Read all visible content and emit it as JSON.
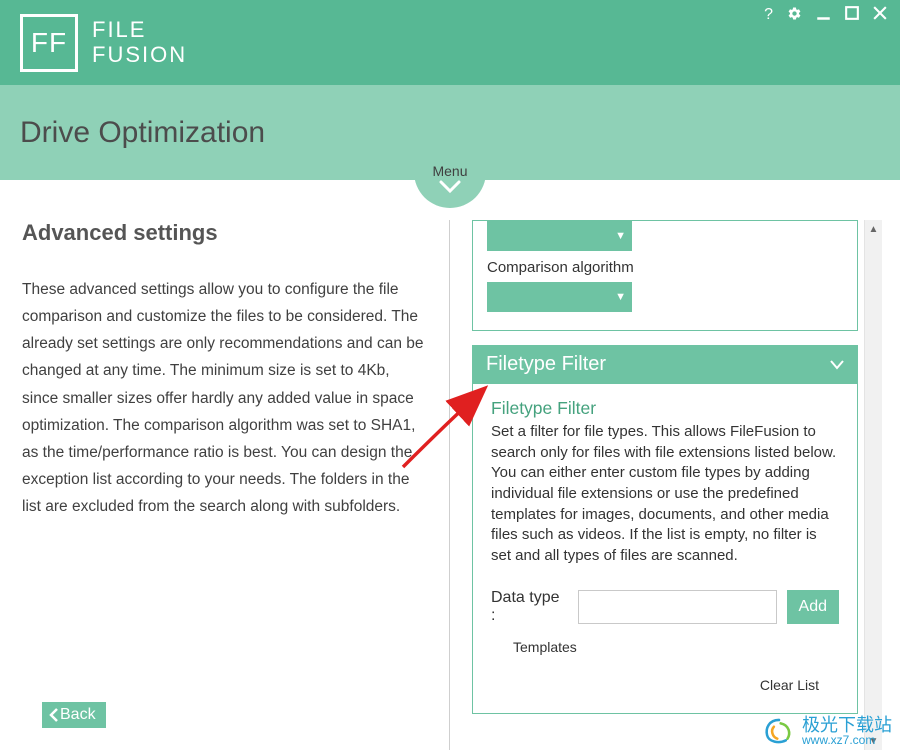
{
  "app": {
    "logo_short": "FF",
    "logo_line1": "FILE",
    "logo_line2": "FUSION"
  },
  "window_controls": {
    "help": "?",
    "settings_icon": "gear",
    "minimize": "minimize",
    "maximize": "maximize",
    "close": "close"
  },
  "header": {
    "page_title": "Drive Optimization",
    "menu_label": "Menu"
  },
  "left": {
    "title": "Advanced settings",
    "description": "These advanced settings allow you to configure the file comparison and customize the files to be considered. The already set settings are only recommendations and can be changed at any time. The minimum size is set to 4Kb, since smaller sizes offer hardly any added value in space optimization. The comparison algorithm was set to SHA1, as the time/performance ratio is best. You can design the exception list according to your needs. The folders in the list are excluded from the search along with subfolders.",
    "back_label": "Back"
  },
  "right": {
    "comparison_label": "Comparison algorithm",
    "filter_header": "Filetype Filter",
    "filter_title": "Filetype Filter",
    "filter_desc": "Set a filter for file types. This allows FileFusion to search only for files with file extensions listed below. You can either enter custom file types by adding individual file extensions or use the predefined templates for images, documents, and other media files such as videos. If the list is empty, no filter is set and all types of files are scanned.",
    "datatype_label": "Data type :",
    "datatype_value": "",
    "add_label": "Add",
    "templates_label": "Templates",
    "clear_list_label": "Clear List"
  },
  "watermark": {
    "cn": "极光下载站",
    "url": "www.xz7.com"
  }
}
